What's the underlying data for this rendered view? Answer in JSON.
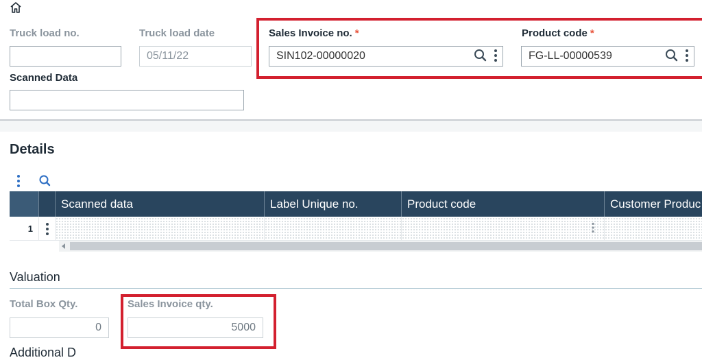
{
  "header": {
    "home_icon": "home-icon"
  },
  "fields": {
    "truck_load_no": {
      "label": "Truck load no.",
      "value": ""
    },
    "truck_load_date": {
      "label": "Truck load date",
      "value": "05/11/22"
    },
    "sales_invoice_no": {
      "label": "Sales Invoice no.",
      "required": "*",
      "value": "SIN102-00000020"
    },
    "product_code": {
      "label": "Product code",
      "required": "*",
      "value": "FG-LL-00000539"
    },
    "scanned_data": {
      "label": "Scanned Data",
      "value": ""
    }
  },
  "details": {
    "title": "Details",
    "grid": {
      "columns": [
        "Scanned data",
        "Label Unique no.",
        "Product code",
        "Customer Produc"
      ],
      "rows": [
        {
          "row_number": "1"
        }
      ]
    }
  },
  "valuation": {
    "title": "Valuation",
    "total_box_qty": {
      "label": "Total Box Qty.",
      "value": "0"
    },
    "sales_invoice_qty": {
      "label": "Sales Invoice qty.",
      "value": "5000"
    }
  },
  "footer": {
    "next_section_partial": "Additional D"
  },
  "colors": {
    "grid_header": "#29455e",
    "highlight": "#d3202f",
    "required": "#e8543c"
  }
}
